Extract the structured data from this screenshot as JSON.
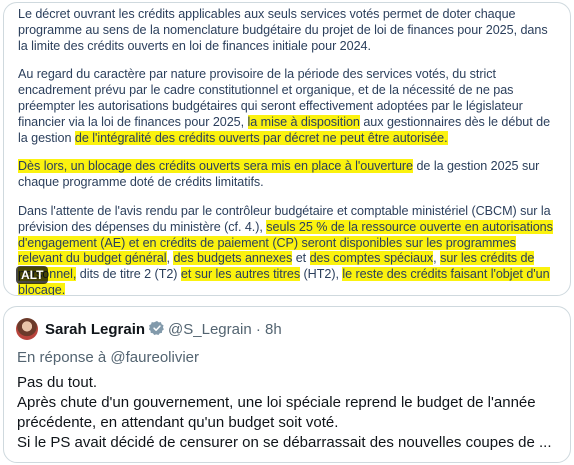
{
  "image_card": {
    "alt_badge": "ALT",
    "paragraphs": [
      [
        {
          "t": "Le décret ouvrant les crédits applicables aux seuls services votés permet de doter chaque programme au sens de la nomenclature budgétaire du projet de loi de finances pour 2025, dans la limite des crédits ouverts en loi de finances initiale pour 2024.",
          "h": false
        }
      ],
      [
        {
          "t": "Au regard du caractère par nature provisoire de la période des services votés, du strict encadrement prévu par le cadre constitutionnel et organique, et de la nécessité de ne pas préempter les autorisations budgétaires qui seront effectivement adoptées par le législateur financier via la loi de finances pour 2025, ",
          "h": false
        },
        {
          "t": "la mise à disposition",
          "h": true
        },
        {
          "t": " aux gestionnaires dès le début de la gestion ",
          "h": false
        },
        {
          "t": "de l'intégralité des crédits ouverts par décret ne peut être autorisée.",
          "h": true
        }
      ],
      [
        {
          "t": "Dès lors, un blocage des crédits ouverts sera mis en place à l'ouverture",
          "h": true
        },
        {
          "t": " de la gestion 2025 sur chaque programme doté de crédits limitatifs.",
          "h": false
        }
      ],
      [
        {
          "t": "Dans l'attente de l'avis rendu par le contrôleur budgétaire et comptable ministériel (CBCM) sur la prévision des dépenses du ministère (cf. 4.), ",
          "h": false
        },
        {
          "t": "seuls 25 % de la ressource ouverte en autorisations d'engagement (AE) et en crédits de paiement (CP) seront disponibles sur les programmes relevant du budget général",
          "h": true
        },
        {
          "t": ", ",
          "h": false
        },
        {
          "t": "des budgets annexes",
          "h": true
        },
        {
          "t": " et ",
          "h": false
        },
        {
          "t": "des comptes spéciaux",
          "h": true
        },
        {
          "t": ", ",
          "h": false
        },
        {
          "t": "sur les crédits de personnel,",
          "h": true
        },
        {
          "t": " dits de titre 2 (T2) ",
          "h": false
        },
        {
          "t": "et sur les autres titres",
          "h": true
        },
        {
          "t": " (HT2), ",
          "h": false
        },
        {
          "t": "le reste des crédits faisant l'objet d'un blocage.",
          "h": true
        }
      ]
    ]
  },
  "tweet": {
    "author_name": "Sarah Legrain",
    "verified_icon": "verified-badge-icon",
    "handle": "@S_Legrain",
    "separator": "·",
    "time": "8h",
    "reply_to": "En réponse à @faureolivier",
    "body_lines": [
      "Pas du tout.",
      "Après chute d'un gouvernement, une loi spéciale reprend le budget de l'année",
      "précédente, en attendant qu'un budget soit voté.",
      "Si le PS avait décidé de censurer on se débarrassait des nouvelles coupes de ..."
    ]
  },
  "colors": {
    "highlight": "#fbf20f",
    "doc_text": "#2b3f5c",
    "verified": "#829aab",
    "secondary_text": "#536471"
  }
}
